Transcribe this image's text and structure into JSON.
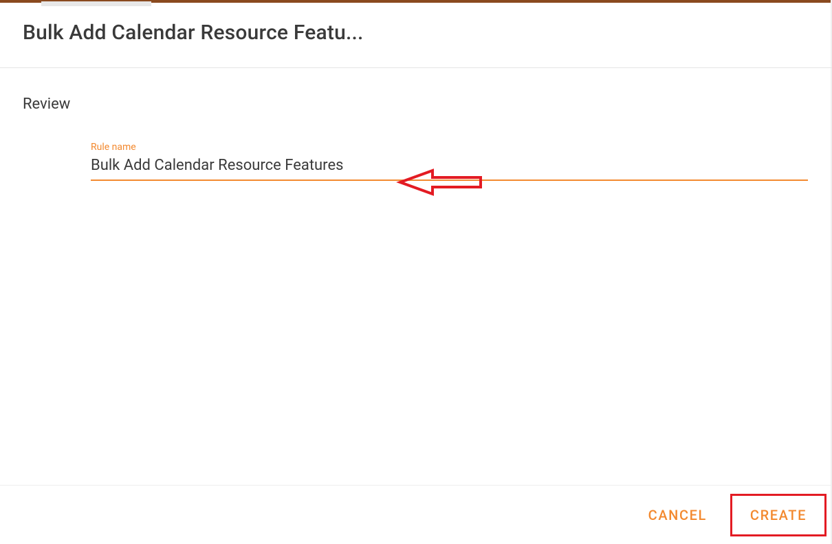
{
  "header": {
    "title": "Bulk Add Calendar Resource Featu..."
  },
  "content": {
    "section_title": "Review",
    "field": {
      "label": "Rule name",
      "value": "Bulk Add Calendar Resource Features"
    }
  },
  "footer": {
    "cancel_label": "CANCEL",
    "create_label": "CREATE"
  },
  "colors": {
    "accent": "#f3892f",
    "annotation": "#e31b23"
  }
}
